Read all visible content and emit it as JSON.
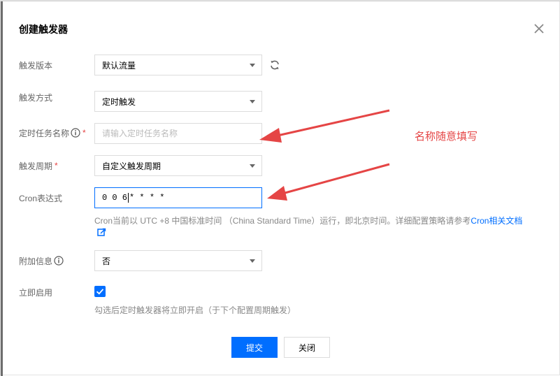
{
  "dialog": {
    "title": "创建触发器"
  },
  "fields": {
    "version": {
      "label": "触发版本",
      "value": "默认流量"
    },
    "method": {
      "label": "触发方式",
      "value": "定时触发"
    },
    "task_name": {
      "label": "定时任务名称",
      "required_mark": "*",
      "value": "",
      "placeholder": "请输入定时任务名称"
    },
    "period": {
      "label": "触发周期",
      "required_mark": "*",
      "value": "自定义触发周期"
    },
    "cron": {
      "label": "Cron表达式",
      "value_before_cursor": "0 0 6",
      "value_after_cursor": "* * * *",
      "help_text": "Cron当前以 UTC +8 中国标准时间 （China Standard Time）运行，即北京时间。详细配置策略请参考",
      "help_link": "Cron相关文档"
    },
    "extra_info": {
      "label": "附加信息",
      "value": "否"
    },
    "enable_now": {
      "label": "立即启用",
      "checked": true,
      "help_text": "勾选后定时触发器将立即开启（于下个配置周期触发）"
    }
  },
  "buttons": {
    "submit_label": "提交",
    "close_label": "关闭"
  },
  "annotation": {
    "text": "名称随意填写",
    "color": "#e54545"
  },
  "colors": {
    "primary": "#006eff",
    "required": "#e54545"
  },
  "icons": {
    "close": "close-icon",
    "refresh": "refresh-icon",
    "info": "info-icon",
    "external_link": "external-link-icon",
    "dropdown": "chevron-down-icon",
    "check": "check-icon"
  }
}
